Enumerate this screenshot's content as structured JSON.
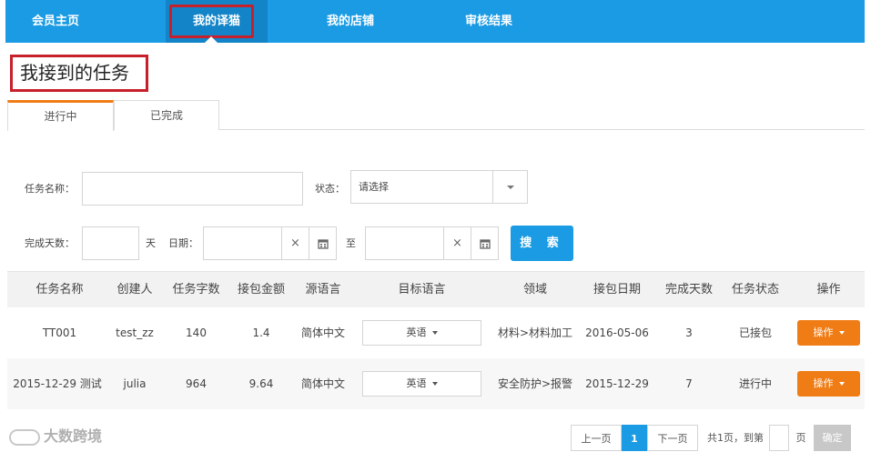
{
  "nav": {
    "items": [
      "会员主页",
      "我的译猫",
      "我的店铺",
      "审核结果"
    ],
    "active_index": 1
  },
  "page_title": "我接到的任务",
  "tabs": [
    "进行中",
    "已完成"
  ],
  "active_tab": 0,
  "form": {
    "task_name_label": "任务名称：",
    "task_name_value": "",
    "status_label": "状态：",
    "status_value": "请选择",
    "days_label": "完成天数：",
    "days_value": "",
    "days_unit": "天",
    "date_label": "日期：",
    "date_to": "至",
    "date_from_value": "",
    "date_to_value": "",
    "search_label": "搜 索",
    "clear_icon": "×",
    "calendar_icon": "calendar-icon"
  },
  "table": {
    "headers": [
      "任务名称",
      "创建人",
      "任务字数",
      "接包金额",
      "源语言",
      "目标语言",
      "领域",
      "接包日期",
      "完成天数",
      "任务状态",
      "操作"
    ],
    "rows": [
      {
        "name": "TT001",
        "creator": "test_zz",
        "words": "140",
        "amount": "1.4",
        "source": "简体中文",
        "target": "英语",
        "domain": "材料>材料加工",
        "date": "2016-05-06",
        "days": "3",
        "status": "已接包",
        "action": "操作"
      },
      {
        "name": "2015-12-29 测试",
        "creator": "julia",
        "words": "964",
        "amount": "9.64",
        "source": "简体中文",
        "target": "英语",
        "domain": "安全防护>报警",
        "date": "2015-12-29",
        "days": "7",
        "status": "进行中",
        "action": "操作"
      }
    ]
  },
  "pagination": {
    "prev": "上一页",
    "current": "1",
    "next": "下一页",
    "total": "共1页，到第",
    "page_input": "",
    "page_unit": "页",
    "go": "确定"
  },
  "watermark": "大数跨境",
  "colors": {
    "primary": "#1a9be3",
    "accent": "#f07c15",
    "highlight_border": "#c8202a"
  }
}
